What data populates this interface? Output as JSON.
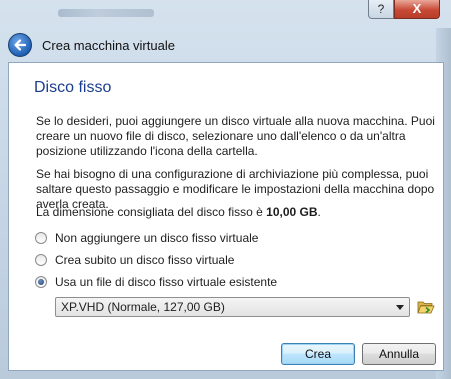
{
  "window": {
    "help_label": "?",
    "close_label": "X",
    "wizard_title": "Crea macchina virtuale"
  },
  "page": {
    "title": "Disco fisso",
    "paragraph1": "Se lo desideri, puoi aggiungere un disco virtuale alla nuova macchina. Puoi creare un nuovo file di disco, selezionare uno dall'elenco o da un'altra posizione utilizzando l'icona della cartella.",
    "paragraph2": "Se hai bisogno di una configurazione di archiviazione più complessa, puoi saltare questo passaggio e modificare le impostazioni della macchina dopo averla creata.",
    "recommended_prefix": "La dimensione consigliata del disco fisso è ",
    "recommended_size": "10,00 GB",
    "recommended_suffix": ".",
    "options": [
      {
        "label": "Non aggiungere un disco fisso virtuale",
        "checked": false
      },
      {
        "label": "Crea subito un disco fisso virtuale",
        "checked": false
      },
      {
        "label": "Usa un file di disco fisso virtuale esistente",
        "checked": true
      }
    ],
    "disk_selection": "XP.VHD (Normale, 127,00 GB)"
  },
  "buttons": {
    "create_label": "Crea",
    "cancel_label": "Annulla"
  },
  "icons": {
    "back": "back-arrow-icon",
    "folder": "folder-open-icon"
  },
  "colors": {
    "title_blue": "#1a3e8c",
    "close_red": "#c84a36"
  }
}
